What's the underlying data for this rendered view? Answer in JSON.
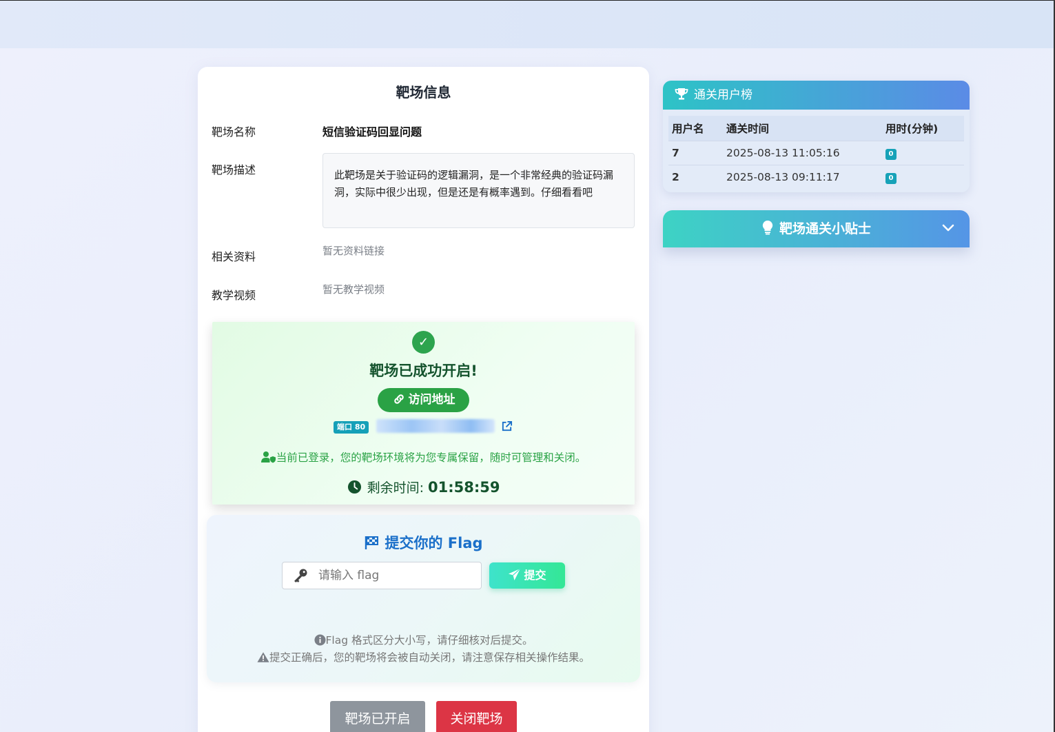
{
  "info": {
    "title": "靶场信息",
    "name_label": "靶场名称",
    "name_value": "短信验证码回显问题",
    "desc_label": "靶场描述",
    "desc_value": "此靶场是关于验证码的逻辑漏洞，是一个非常经典的验证码漏洞，实际中很少出现，但是还是有概率遇到。仔细看看吧",
    "material_label": "相关资料",
    "material_value": "暂无资料链接",
    "video_label": "教学视频",
    "video_value": "暂无教学视频"
  },
  "success": {
    "title": "靶场已成功开启!",
    "visit_label": "访问地址",
    "port_badge": "端口 80",
    "login_note": "当前已登录，您的靶场环境将为您专属保留，随时可管理和关闭。",
    "remain_label": "剩余时间:",
    "remain_time": "01:58:59"
  },
  "flag": {
    "title": "提交你的 Flag",
    "placeholder": "请输入 flag",
    "submit_label": "提交",
    "hint1": "Flag 格式区分大小写，请仔细核对后提交。",
    "hint2": "提交正确后，您的靶场将会被自动关闭，请注意保存相关操作结果。"
  },
  "actions": {
    "opened_label": "靶场已开启",
    "close_label": "关闭靶场"
  },
  "leaderboard": {
    "title": "通关用户榜",
    "columns": [
      "用户名",
      "通关时间",
      "用时(分钟)"
    ],
    "rows": [
      {
        "user": "7",
        "time": "2025-08-13 11:05:16",
        "minutes": "0"
      },
      {
        "user": "2",
        "time": "2025-08-13 09:11:17",
        "minutes": "0"
      }
    ]
  },
  "tips": {
    "title": "靶场通关小贴士"
  },
  "colors": {
    "success_green": "#2aa245",
    "flag_blue": "#1a6fc9",
    "danger_red": "#dc3545",
    "gray_button": "#8e959d"
  }
}
